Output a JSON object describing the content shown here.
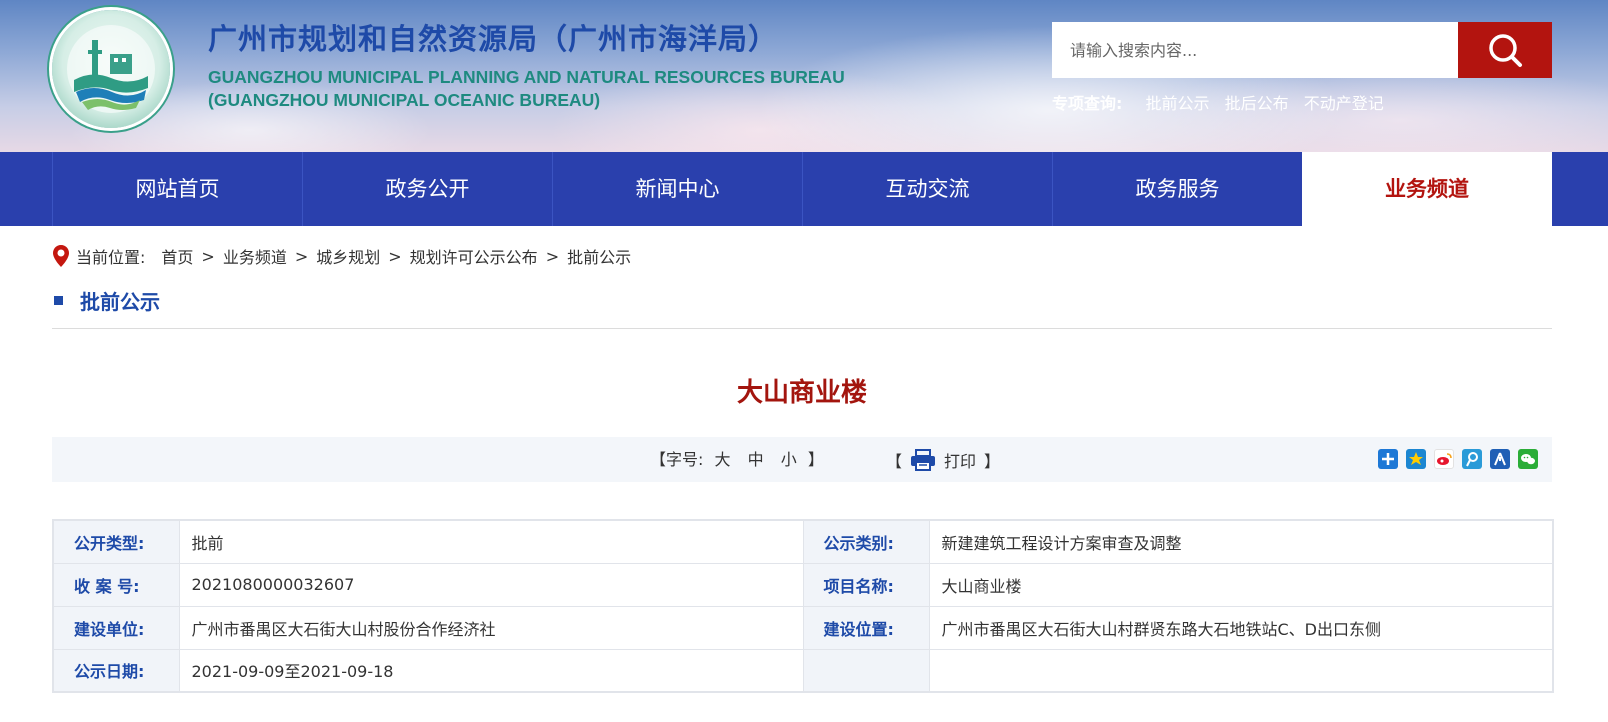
{
  "header": {
    "title_cn": "广州市规划和自然资源局（广州市海洋局）",
    "title_en_line1": "GUANGZHOU MUNICIPAL PLANNING AND NATURAL RESOURCES BUREAU",
    "title_en_line2": "(GUANGZHOU MUNICIPAL OCEANIC BUREAU)",
    "logo_icon": "bureau-emblem-icon"
  },
  "search": {
    "placeholder": "请输入搜索内容...",
    "button_icon": "search-icon"
  },
  "quick_links": {
    "label": "专项查询:",
    "items": [
      "批前公示",
      "批后公布",
      "不动产登记"
    ]
  },
  "nav": {
    "items": [
      "网站首页",
      "政务公开",
      "新闻中心",
      "互动交流",
      "政务服务",
      "业务频道"
    ],
    "active": "业务频道"
  },
  "breadcrumb": {
    "label": "当前位置:",
    "items": [
      "首页",
      "业务频道",
      "城乡规划",
      "规划许可公示公布",
      "批前公示"
    ],
    "separator": ">"
  },
  "section": {
    "title": "批前公示"
  },
  "article": {
    "title": "大山商业楼"
  },
  "toolbar": {
    "fontsize_label": "【字号:",
    "fontsize_options": [
      "大",
      "中",
      "小"
    ],
    "fontsize_close": "】",
    "print_open": "【",
    "print_label": "打印",
    "print_close": "】",
    "share_icons": [
      "share-plus-icon",
      "qzone-icon",
      "weibo-icon",
      "tencent-weibo-icon",
      "renren-icon",
      "wechat-icon"
    ]
  },
  "info": {
    "rows": [
      {
        "l1": "公开类型:",
        "v1": "批前",
        "l2": "公示类别:",
        "v2": "新建建筑工程设计方案审查及调整"
      },
      {
        "l1": "收 案 号:",
        "v1": "2021080000032607",
        "l2": "项目名称:",
        "v2": "大山商业楼"
      },
      {
        "l1": "建设单位:",
        "v1": "广州市番禺区大石街大山村股份合作经济社",
        "l2": "建设位置:",
        "v2": "广州市番禺区大石街大山村群贤东路大石地铁站C、D出口东侧"
      },
      {
        "l1": "公示日期:",
        "v1": "2021-09-09至2021-09-18",
        "l2": "",
        "v2": ""
      }
    ]
  },
  "colors": {
    "brand_blue": "#2a40ad",
    "title_blue": "#1e4aa8",
    "accent_red": "#b3140f",
    "teal": "#1e8a80"
  }
}
